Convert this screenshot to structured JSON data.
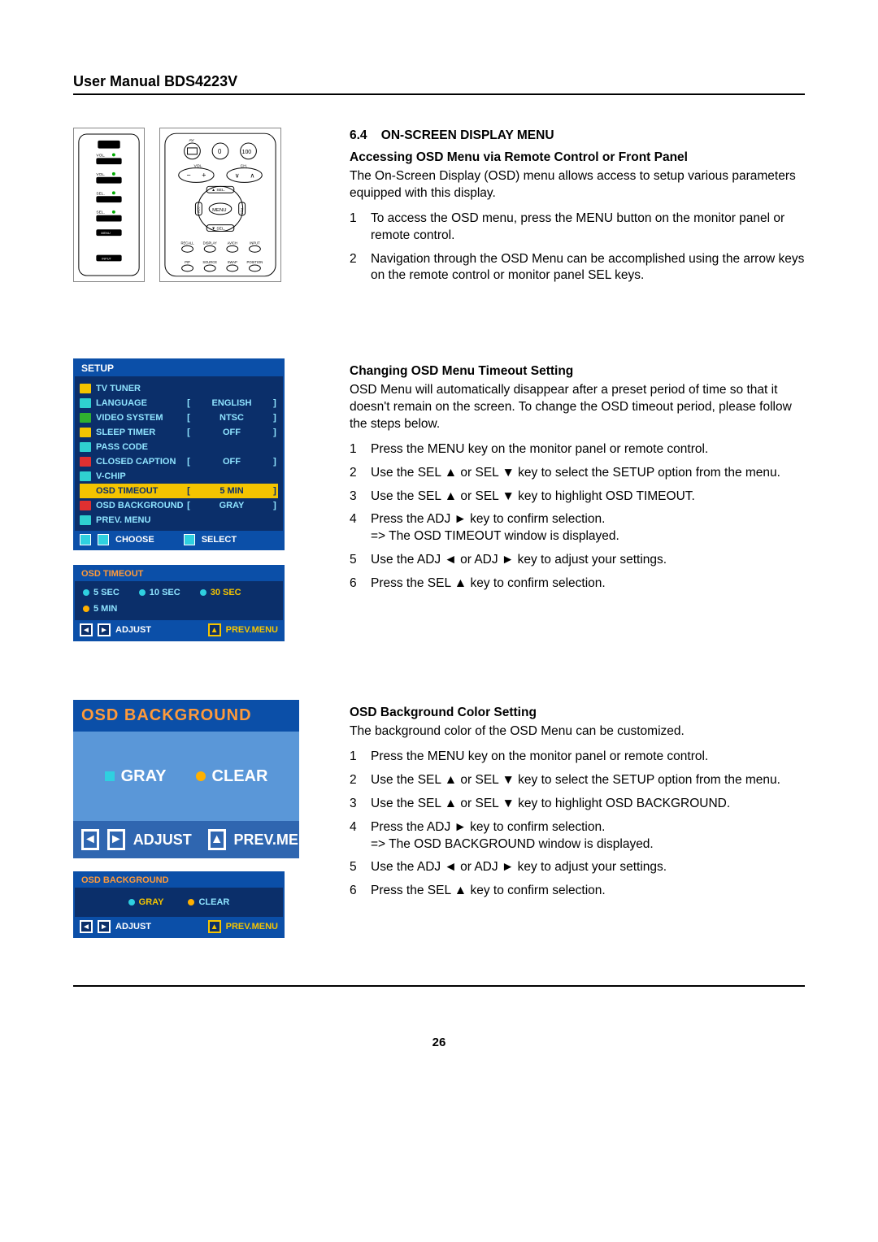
{
  "header": {
    "title": "User Manual BDS4223V"
  },
  "page_number": "26",
  "section": {
    "num": "6.4",
    "title": "ON-SCREEN DISPLAY MENU",
    "sub1_title": "Accessing OSD Menu via Remote Control or Front Panel",
    "sub1_body": "The On-Screen Display (OSD) menu allows access to setup various parameters equipped with this display.",
    "sub1_steps": [
      "To access the OSD menu, press the MENU button on the monitor panel or remote control.",
      "Navigation through the OSD Menu can be accomplished using the arrow keys on the remote control or monitor panel SEL keys."
    ],
    "sub2_title": "Changing OSD Menu Timeout Setting",
    "sub2_body": "OSD Menu will automatically disappear after a preset period of time so that it doesn't remain on the screen. To change the OSD timeout period, please follow the steps below.",
    "sub2_steps": [
      "Press the MENU key on the monitor panel or remote control.",
      "Use the SEL ▲ or SEL ▼ key to select the SETUP option from the menu.",
      "Use the SEL ▲ or SEL ▼ key to highlight OSD TIMEOUT.",
      "Press the ADJ ► key to confirm selection.\n=> The OSD TIMEOUT window is displayed.",
      "Use the ADJ ◄ or ADJ ► key to adjust your settings.",
      "Press the SEL ▲ key to confirm selection."
    ],
    "sub3_title": "OSD Background Color Setting",
    "sub3_body": "The background color of the OSD Menu can be customized.",
    "sub3_steps": [
      "Press the MENU key on the monitor panel or remote control.",
      "Use the SEL ▲ or SEL ▼ key to select the SETUP option from the menu.",
      "Use the SEL ▲ or SEL ▼ key to highlight OSD BACKGROUND.",
      "Press the ADJ ► key to confirm selection.\n=> The OSD BACKGROUND window is displayed.",
      "Use the ADJ ◄ or ADJ ► key to adjust your settings.",
      "Press the SEL ▲ key to confirm selection."
    ]
  },
  "panel_buttons": [
    "VOL.",
    "VOL.",
    "SEL.",
    "SEL.",
    "MENU",
    "INPUT"
  ],
  "remote": {
    "top": [
      "0",
      "100"
    ],
    "vol": "VOL.",
    "ch": "CH.",
    "sel_up": "▲ SEL.",
    "sel_dn": "▼ SEL.",
    "adj_l": "ADJ",
    "adj_r": "ADJ",
    "menu": "MENU",
    "row1": [
      "RECALL",
      "DISPLAY",
      "AV/CH",
      "INPUT"
    ],
    "row2": [
      "PIP",
      "SOURCE",
      "SWAP",
      "POSITION"
    ]
  },
  "osd_setup": {
    "title": "SETUP",
    "rows": [
      {
        "lbl": "TV TUNER",
        "val": "",
        "br": false
      },
      {
        "lbl": "LANGUAGE",
        "val": "ENGLISH",
        "br": true
      },
      {
        "lbl": "VIDEO SYSTEM",
        "val": "NTSC",
        "br": true
      },
      {
        "lbl": "SLEEP TIMER",
        "val": "OFF",
        "br": true
      },
      {
        "lbl": "PASS CODE",
        "val": "",
        "br": false
      },
      {
        "lbl": "CLOSED CAPTION",
        "val": "OFF",
        "br": true
      },
      {
        "lbl": "V-CHIP",
        "val": "",
        "br": false
      },
      {
        "lbl": "OSD TIMEOUT",
        "val": "5 MIN",
        "br": true,
        "hl": true
      },
      {
        "lbl": "OSD BACKGROUND",
        "val": "GRAY",
        "br": true
      },
      {
        "lbl": "PREV. MENU",
        "val": "",
        "br": false
      }
    ],
    "footer_choose": "CHOOSE",
    "footer_select": "SELECT"
  },
  "osd_timeout": {
    "title": "OSD TIMEOUT",
    "options": [
      "5 SEC",
      "10 SEC",
      "30 SEC",
      "5 MIN"
    ],
    "selected": "5 MIN",
    "adjust": "ADJUST",
    "prev": "PREV.MENU"
  },
  "osd_bg_large": {
    "title": "OSD BACKGROUND",
    "opt1": "GRAY",
    "opt2": "CLEAR",
    "adjust": "ADJUST",
    "prev": "PREV.MENU"
  },
  "osd_bg_small": {
    "title": "OSD BACKGROUND",
    "opt1": "GRAY",
    "opt2": "CLEAR",
    "adjust": "ADJUST",
    "prev": "PREV.MENU"
  }
}
